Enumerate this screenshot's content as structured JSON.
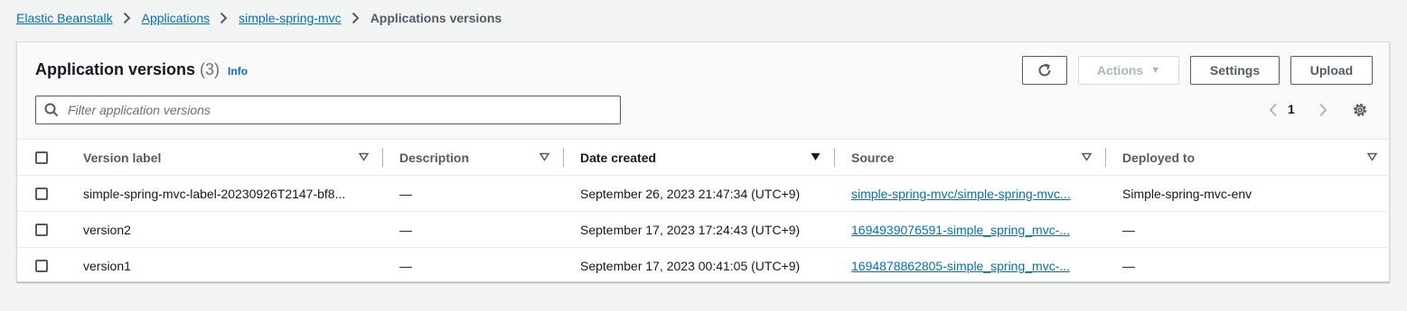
{
  "breadcrumb": {
    "items": [
      "Elastic Beanstalk",
      "Applications",
      "simple-spring-mvc"
    ],
    "current": "Applications versions"
  },
  "header": {
    "title": "Application versions",
    "count": "(3)",
    "info": "Info"
  },
  "toolbar": {
    "actions_label": "Actions",
    "settings_label": "Settings",
    "upload_label": "Upload"
  },
  "search": {
    "placeholder": "Filter application versions",
    "value": ""
  },
  "pagination": {
    "current_page": "1"
  },
  "table": {
    "columns": [
      "Version label",
      "Description",
      "Date created",
      "Source",
      "Deployed to"
    ],
    "sorted_column": "Date created",
    "rows": [
      {
        "label": "simple-spring-mvc-label-20230926T2147-bf8...",
        "description": "—",
        "date": "September 26, 2023 21:47:34 (UTC+9)",
        "source": "simple-spring-mvc/simple-spring-mvc...",
        "deployed": "Simple-spring-mvc-env"
      },
      {
        "label": "version2",
        "description": "—",
        "date": "September 17, 2023 17:24:43 (UTC+9)",
        "source": "1694939076591-simple_spring_mvc-...",
        "deployed": "—"
      },
      {
        "label": "version1",
        "description": "—",
        "date": "September 17, 2023 00:41:05 (UTC+9)",
        "source": "1694878862805-simple_spring_mvc-...",
        "deployed": "—"
      }
    ]
  },
  "colors": {
    "link": "#0073bb",
    "text": "#16191f",
    "secondary": "#545b64",
    "background": "#f2f3f3"
  }
}
